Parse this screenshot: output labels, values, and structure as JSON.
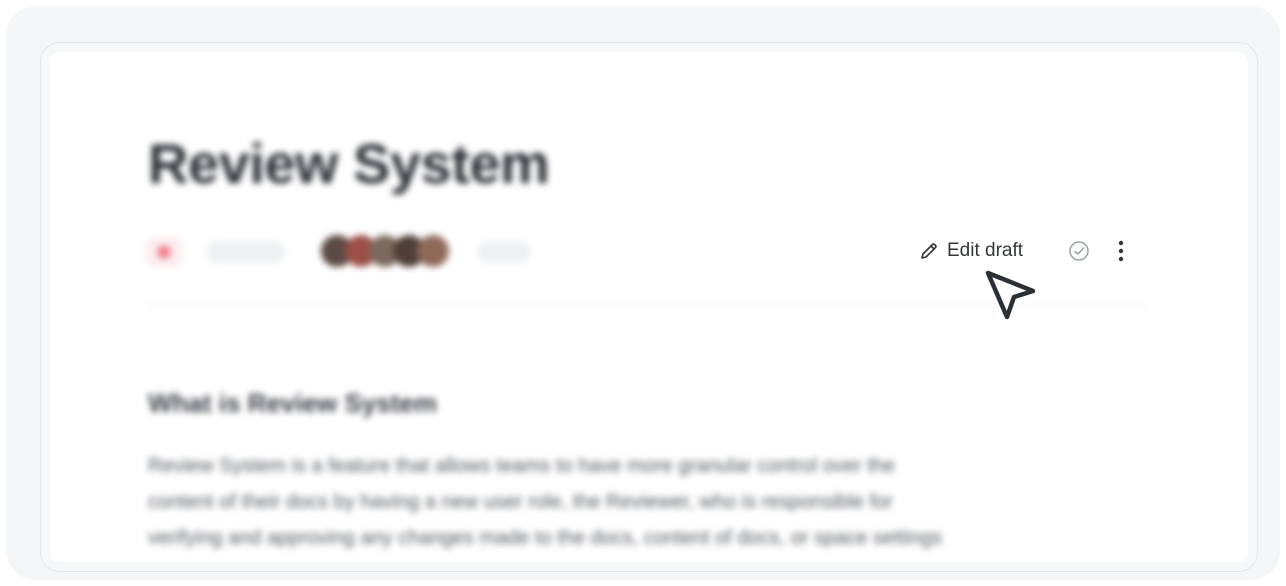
{
  "document": {
    "title": "Review System",
    "section_heading": "What is Review System",
    "body_lines": [
      "Review System is a feature that allows teams to have more granular control over the",
      "content of their docs by having a new user role, the Reviewer, who is responsible for",
      "verifying and approving any changes made to the docs, content of docs, or space settings"
    ]
  },
  "toolbar": {
    "edit_draft_label": "Edit draft",
    "icons": {
      "edit": "pencil-icon",
      "approve": "check-circle-icon",
      "more": "more-vertical-icon"
    }
  },
  "colors": {
    "status_badge": "#f07b8a",
    "text": "#33363b",
    "frame": "#f4f6f7"
  }
}
